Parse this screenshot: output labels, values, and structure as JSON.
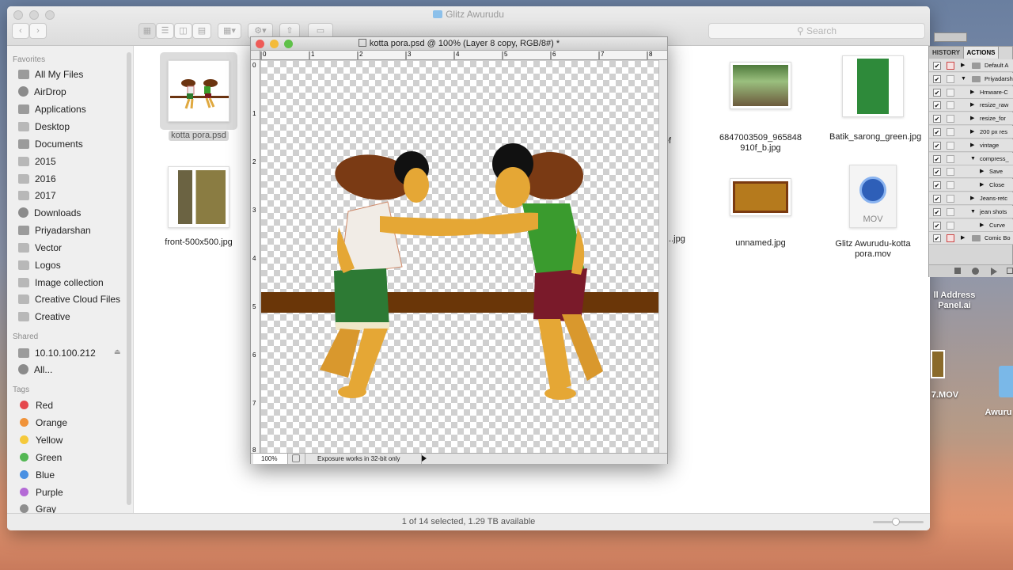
{
  "finder": {
    "title": "Glitz Awurudu",
    "search_placeholder": "Search",
    "favorites_header": "Favorites",
    "favorites": [
      {
        "label": "All My Files",
        "icon": "all-files-icon"
      },
      {
        "label": "AirDrop",
        "icon": "airdrop-icon"
      },
      {
        "label": "Applications",
        "icon": "applications-icon"
      },
      {
        "label": "Desktop",
        "icon": "folder-icon"
      },
      {
        "label": "Documents",
        "icon": "documents-icon"
      },
      {
        "label": "2015",
        "icon": "folder-icon"
      },
      {
        "label": "2016",
        "icon": "folder-icon"
      },
      {
        "label": "2017",
        "icon": "folder-icon"
      },
      {
        "label": "Downloads",
        "icon": "downloads-icon"
      },
      {
        "label": "Priyadarshan",
        "icon": "home-icon"
      },
      {
        "label": "Vector",
        "icon": "folder-icon"
      },
      {
        "label": "Logos",
        "icon": "folder-icon"
      },
      {
        "label": "Image collection",
        "icon": "folder-icon"
      },
      {
        "label": "Creative Cloud Files",
        "icon": "folder-icon"
      },
      {
        "label": "Creative",
        "icon": "folder-icon"
      }
    ],
    "shared_header": "Shared",
    "shared": [
      {
        "label": "10.10.100.212",
        "icon": "server-icon"
      },
      {
        "label": "All...",
        "icon": "network-icon"
      }
    ],
    "tags_header": "Tags",
    "tags": [
      {
        "label": "Red",
        "color": "#e5484d"
      },
      {
        "label": "Orange",
        "color": "#f0933a"
      },
      {
        "label": "Yellow",
        "color": "#f5c93b"
      },
      {
        "label": "Green",
        "color": "#54b754"
      },
      {
        "label": "Blue",
        "color": "#4a90e2"
      },
      {
        "label": "Purple",
        "color": "#b46ad6"
      },
      {
        "label": "Gray",
        "color": "#8e8e8e"
      }
    ],
    "files": [
      {
        "name": "kotta pora.psd"
      },
      {
        "name": "front-500x500.jpg"
      },
      {
        "name": "...f5cef\n...jpg"
      },
      {
        "name": "...jpg"
      },
      {
        "name": "6847003509_965848\n910f_b.jpg"
      },
      {
        "name": "Batik_sarong_green.jpg"
      },
      {
        "name": "unnamed.jpg"
      },
      {
        "name": "Glitz Awurudu-kotta\npora.mov"
      }
    ],
    "mov_badge": "MOV",
    "status": "1 of 14 selected, 1.29 TB available"
  },
  "photoshop": {
    "title": "kotta pora.psd @ 100% (Layer 8 copy, RGB/8#) *",
    "zoom": "100%",
    "status_info": "Exposure works in 32-bit only",
    "ruler_top": [
      "0",
      "1",
      "2",
      "3",
      "4",
      "5",
      "6",
      "7",
      "8"
    ],
    "ruler_left": [
      "0",
      "1",
      "2",
      "3",
      "4",
      "5",
      "6",
      "7",
      "8"
    ]
  },
  "panels": {
    "tab_history": "HISTORY",
    "tab_actions": "ACTIONS",
    "rows": [
      {
        "label": "Default A",
        "indent": 0,
        "folder": true,
        "expanded": false,
        "red": true
      },
      {
        "label": "Priyadarsh",
        "indent": 0,
        "folder": true,
        "expanded": true,
        "red": false
      },
      {
        "label": "Hmware-C",
        "indent": 1,
        "folder": false,
        "expanded": false,
        "red": false
      },
      {
        "label": "resize_raw",
        "indent": 1,
        "folder": false,
        "expanded": false,
        "red": false
      },
      {
        "label": "resize_for",
        "indent": 1,
        "folder": false,
        "expanded": false,
        "red": false
      },
      {
        "label": "200 px res",
        "indent": 1,
        "folder": false,
        "expanded": false,
        "red": false
      },
      {
        "label": "vintage",
        "indent": 1,
        "folder": false,
        "expanded": false,
        "red": false
      },
      {
        "label": "compress_",
        "indent": 1,
        "folder": false,
        "expanded": true,
        "red": false
      },
      {
        "label": "Save",
        "indent": 2,
        "folder": false,
        "expanded": false,
        "red": false
      },
      {
        "label": "Close",
        "indent": 2,
        "folder": false,
        "expanded": false,
        "red": false
      },
      {
        "label": "Jeans-retc",
        "indent": 1,
        "folder": false,
        "expanded": false,
        "red": false
      },
      {
        "label": "jean shots",
        "indent": 1,
        "folder": false,
        "expanded": true,
        "red": false
      },
      {
        "label": "Curve",
        "indent": 2,
        "folder": false,
        "expanded": false,
        "red": false
      },
      {
        "label": "Comic Bo",
        "indent": 0,
        "folder": true,
        "expanded": false,
        "red": true
      }
    ]
  },
  "desktop": {
    "item1": "ll Address\nPanel.ai",
    "item2": "7.MOV",
    "item3": "Awuru"
  }
}
